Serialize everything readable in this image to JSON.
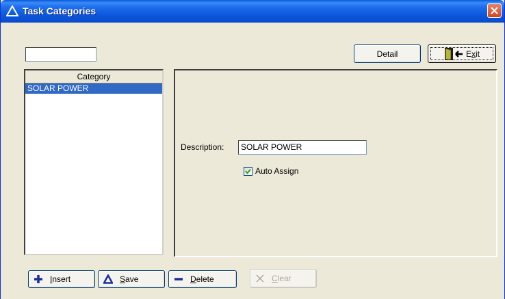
{
  "window": {
    "title": "Task Categories",
    "close_label": "✕"
  },
  "toolbar": {
    "filter_value": "",
    "detail_label": "Detail",
    "exit_label_pre": "E",
    "exit_label_mnemonic": "x",
    "exit_label_post": "it"
  },
  "list": {
    "header": "Category",
    "items": [
      {
        "label": "SOLAR POWER",
        "selected": true
      }
    ]
  },
  "detail": {
    "description_label": "Description:",
    "description_value": "SOLAR POWER",
    "auto_assign_label": "Auto Assign",
    "auto_assign_checked": true
  },
  "actions": {
    "insert_mnemonic": "I",
    "insert_rest": "nsert",
    "save_mnemonic": "S",
    "save_rest": "ave",
    "delete_mnemonic": "D",
    "delete_rest": "elete",
    "clear_mnemonic": "C",
    "clear_rest": "lear"
  },
  "colors": {
    "titlebar": "#0a58e0",
    "selection": "#316ac5",
    "window_bg": "#ece9d8",
    "icon_blue": "#1a2f9e"
  }
}
